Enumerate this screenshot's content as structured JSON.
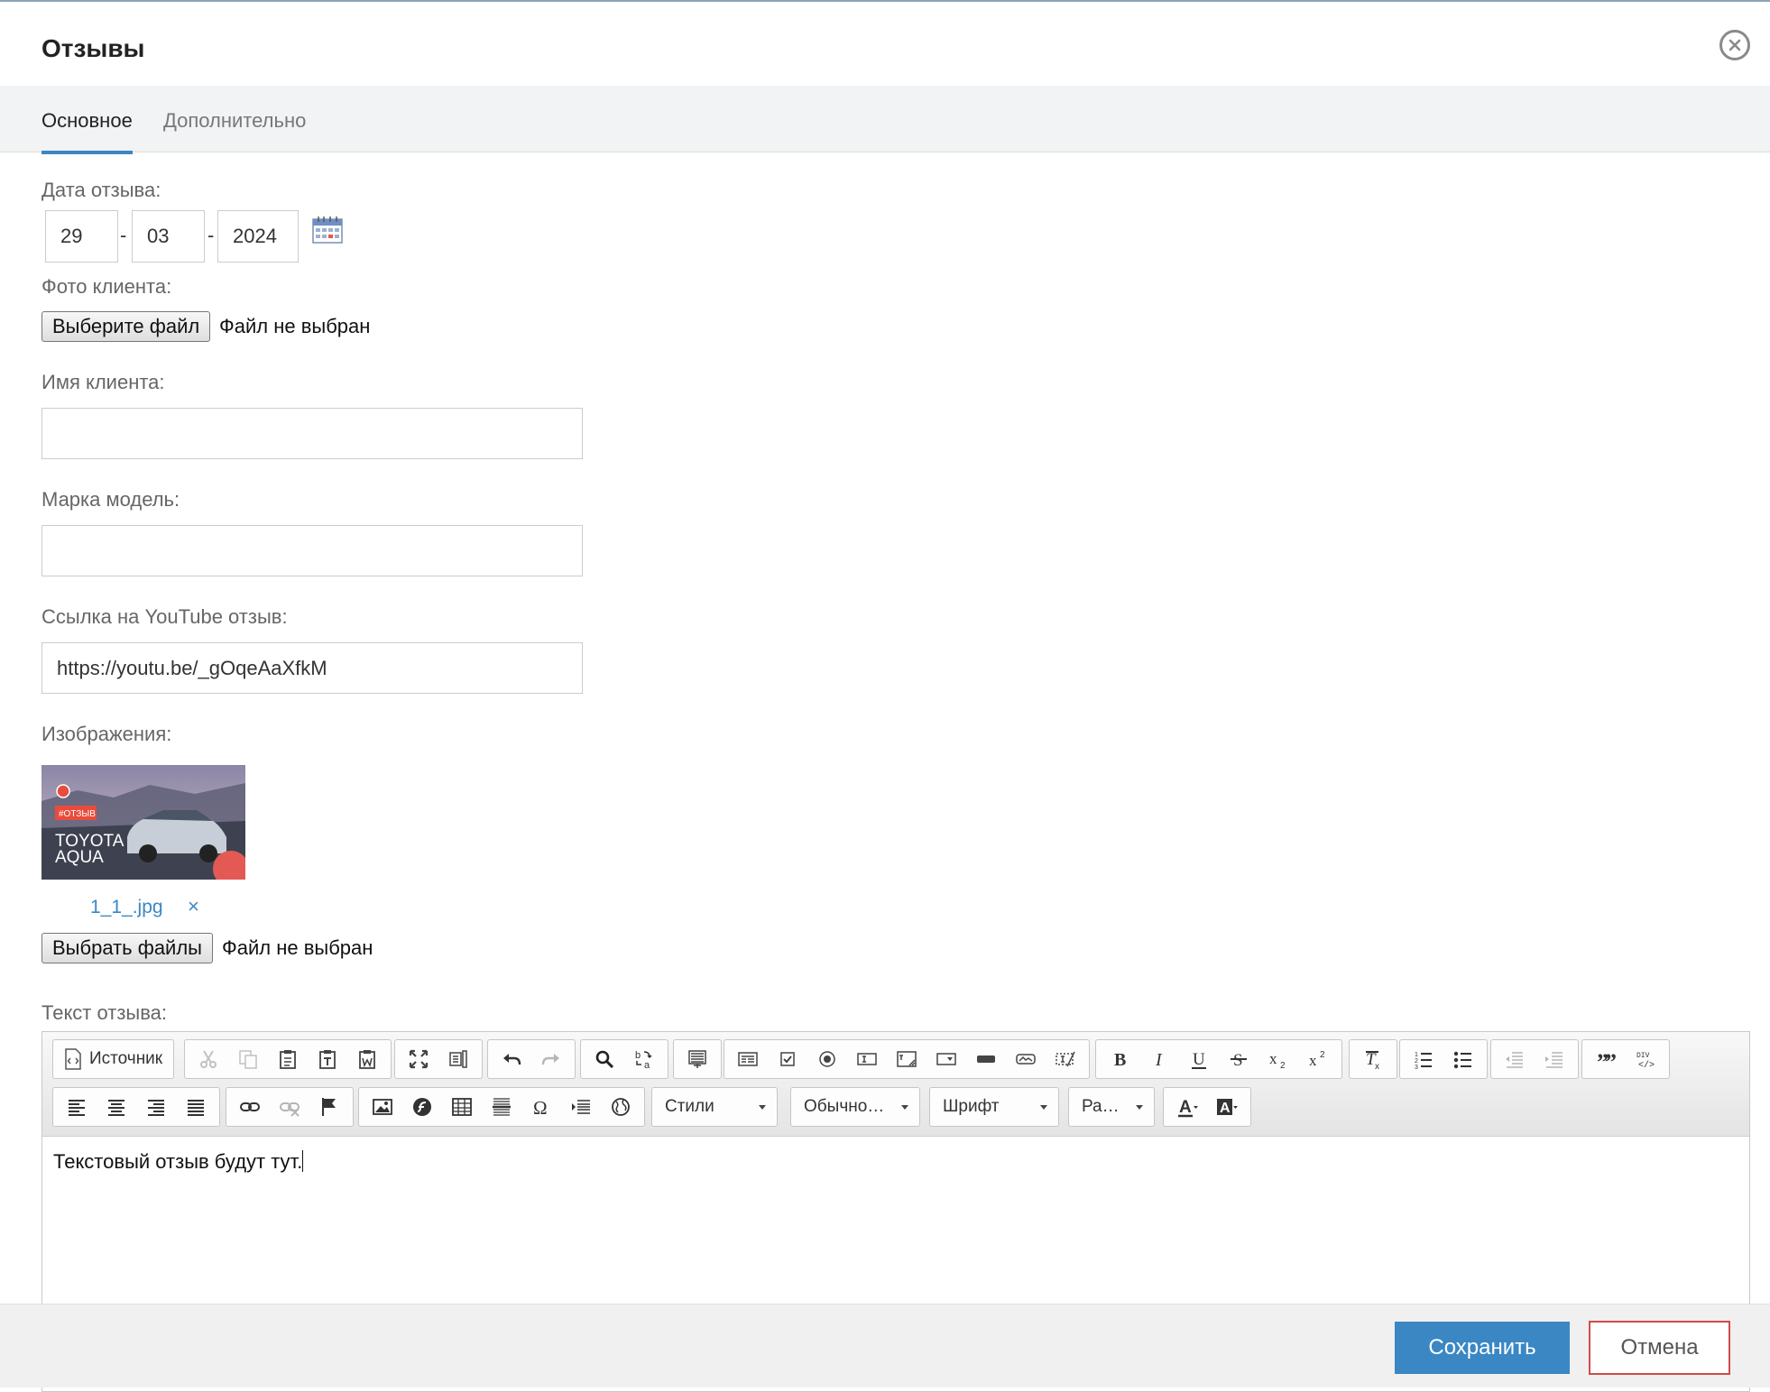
{
  "dialog": {
    "title": "Отзывы"
  },
  "tabs": [
    {
      "label": "Основное",
      "active": true
    },
    {
      "label": "Дополнительно",
      "active": false
    }
  ],
  "form": {
    "date": {
      "label": "Дата отзыва:",
      "day": "29",
      "month": "03",
      "year": "2024",
      "separator": "-"
    },
    "photo": {
      "label": "Фото клиента:",
      "button": "Выберите файл",
      "status": "Файл не выбран"
    },
    "client_name": {
      "label": "Имя клиента:",
      "value": ""
    },
    "car_model": {
      "label": "Марка модель:",
      "value": ""
    },
    "youtube": {
      "label": "Ссылка на YouTube отзыв:",
      "value": "https://youtu.be/_gOqeAaXfkM"
    },
    "images": {
      "label": "Изображения:",
      "thumbnail": {
        "badge": "#ОТЗЫВ",
        "line1": "TOYOTA",
        "line2": "AQUA",
        "filename": "1_1_.jpg",
        "remove": "×"
      },
      "button": "Выбрать файлы",
      "status": "Файл не выбран"
    },
    "review_text": {
      "label": "Текст отзыва:",
      "content": "Текстовый отзыв будут тут."
    }
  },
  "editor": {
    "source_label": "Источник",
    "combos": {
      "styles": "Стили",
      "format": "Обычно…",
      "font": "Шрифт",
      "size": "Ра…"
    },
    "icons": {
      "source": "source-icon",
      "cut": "scissors-icon",
      "copy": "copy-icon",
      "paste": "paste-icon",
      "paste_text": "paste-text-icon",
      "paste_word": "paste-word-icon",
      "maximize": "maximize-icon",
      "show_blocks": "show-blocks-icon",
      "undo": "undo-icon",
      "redo": "redo-icon",
      "find": "search-icon",
      "replace": "replace-icon",
      "select_all": "select-all-icon",
      "form": "form-icon",
      "checkbox": "checkbox-icon",
      "radio": "radio-icon",
      "text_field": "text-field-icon",
      "textarea": "textarea-icon",
      "select": "select-icon",
      "button": "button-icon",
      "image_button": "image-button-icon",
      "hidden_field": "hidden-field-icon",
      "bold": "bold-icon",
      "italic": "italic-icon",
      "underline": "underline-icon",
      "strike": "strike-icon",
      "subscript": "subscript-icon",
      "superscript": "superscript-icon",
      "remove_format": "remove-format-icon",
      "numbered_list": "numbered-list-icon",
      "bulleted_list": "bulleted-list-icon",
      "outdent": "outdent-icon",
      "indent": "indent-icon",
      "blockquote": "blockquote-icon",
      "div": "div-icon"
    }
  },
  "footer": {
    "save": "Сохранить",
    "cancel": "Отмена"
  },
  "colors": {
    "accent": "#3a87c4",
    "cancel_border": "#d04b4b"
  }
}
